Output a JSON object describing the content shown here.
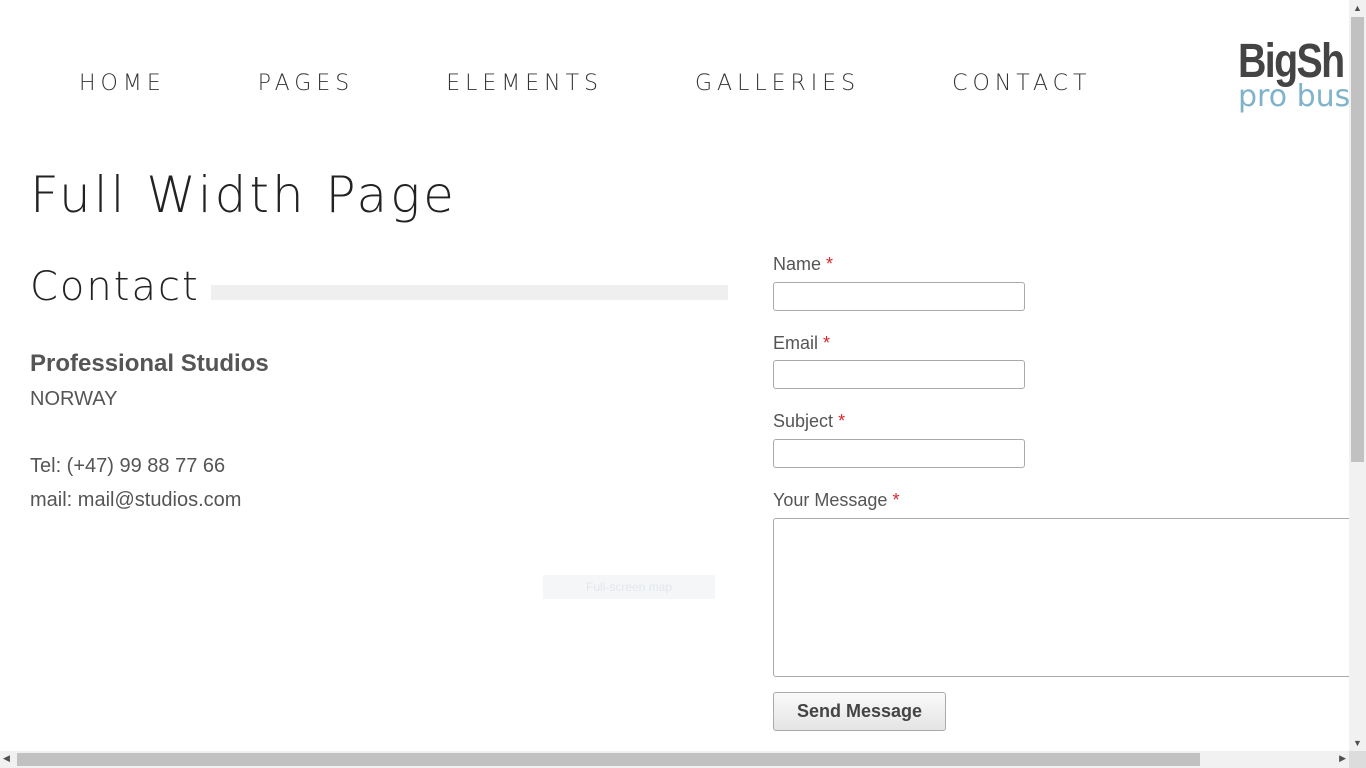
{
  "nav": {
    "items": [
      {
        "label": "HOME"
      },
      {
        "label": "PAGES"
      },
      {
        "label": "ELEMENTS"
      },
      {
        "label": "GALLERIES"
      },
      {
        "label": "CONTACT"
      }
    ]
  },
  "logo": {
    "line1": "BigSh",
    "line2": "pro bus"
  },
  "page": {
    "title": "Full Width Page"
  },
  "contact": {
    "heading": "Contact",
    "company": "Professional Studios",
    "country": "NORWAY",
    "tel": "Tel: (+47) 99 88 77 66",
    "mail": "mail: mail@studios.com",
    "map_link": "Full-screen map"
  },
  "form": {
    "required_mark": "*",
    "name_label": "Name",
    "email_label": "Email",
    "subject_label": "Subject",
    "message_label": "Your Message",
    "name_value": "",
    "email_value": "",
    "subject_value": "",
    "message_value": "",
    "submit_label": "Send Message"
  },
  "scrollbars": {
    "up_arrow": "▲",
    "down_arrow": "▼",
    "left_arrow": "◀",
    "right_arrow": "▶"
  },
  "colors": {
    "required": "#d9262a",
    "logo_accent": "#7fb3cc"
  }
}
